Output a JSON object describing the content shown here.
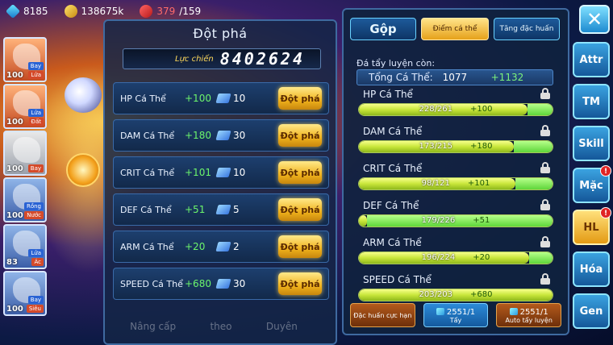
{
  "topbar": {
    "gems": "8185",
    "gold": "138675k",
    "energy_current": "379",
    "energy_max": "/159"
  },
  "team": [
    {
      "level": "100",
      "tag_a": "Bay",
      "tag_b": "Lửa",
      "style": "fire"
    },
    {
      "level": "100",
      "tag_a": "Lửa",
      "tag_b": "Đất",
      "style": "fire"
    },
    {
      "level": "100",
      "tag_a": "",
      "tag_b": "Bay",
      "style": "white"
    },
    {
      "level": "100",
      "tag_a": "Rồng",
      "tag_b": "Nước",
      "style": "blue"
    },
    {
      "level": "83",
      "tag_a": "Lửa",
      "tag_b": "Ác",
      "style": "blue"
    },
    {
      "level": "100",
      "tag_a": "Bay",
      "tag_b": "Siêu",
      "style": "blue"
    }
  ],
  "breakthrough": {
    "title": "Đột phá",
    "power_label": "Lực chiến",
    "power_value": "8402624",
    "button_label": "Đột phá",
    "rows": [
      {
        "name": "HP Cá Thể",
        "bonus": "+100",
        "qty": "10"
      },
      {
        "name": "DAM Cá Thể",
        "bonus": "+180",
        "qty": "30"
      },
      {
        "name": "CRIT Cá Thể",
        "bonus": "+101",
        "qty": "10"
      },
      {
        "name": "DEF Cá Thể",
        "bonus": "+51",
        "qty": "5"
      },
      {
        "name": "ARM Cá Thể",
        "bonus": "+20",
        "qty": "2"
      },
      {
        "name": "SPEED Cá Thể",
        "bonus": "+680",
        "qty": "30"
      }
    ]
  },
  "ghost_nav": [
    "Nâng cấp",
    "theo",
    "Duyên"
  ],
  "right": {
    "tabs": [
      "Gộp",
      "Điểm cá thể",
      "Tăng đặc huấn"
    ],
    "remain_label": "Đá tẩy luyện còn:",
    "total_label": "Tổng Cá Thể:",
    "total_value": "1077",
    "total_bonus": "+1132",
    "stats": [
      {
        "name": "HP Cá Thể",
        "value": "228/261",
        "bonus": "+100",
        "fill": 0.87,
        "bonus_fill": 0.13
      },
      {
        "name": "DAM Cá Thể",
        "value": "173/215",
        "bonus": "+180",
        "fill": 0.8,
        "bonus_fill": 0.2
      },
      {
        "name": "CRIT Cá Thể",
        "value": "98/121",
        "bonus": "+101",
        "fill": 0.81,
        "bonus_fill": 0.19
      },
      {
        "name": "DEF Cá Thể",
        "value": "179/226",
        "bonus": "+51",
        "fill": 0.04,
        "bonus_fill": 0.96
      },
      {
        "name": "ARM Cá Thể",
        "value": "196/224",
        "bonus": "+20",
        "fill": 0.88,
        "bonus_fill": 0.12
      },
      {
        "name": "SPEED Cá Thể",
        "value": "203/203",
        "bonus": "+680",
        "fill": 1.0,
        "bonus_fill": 0.0
      }
    ],
    "actions": {
      "special_label": "Đặc huấn cực hạn",
      "tay_count": "2551/1",
      "tay_label": "Tẩy",
      "auto_count": "2551/1",
      "auto_label": "Auto tẩy luyện"
    }
  },
  "side": {
    "close_label": "✕",
    "buttons": [
      {
        "label": "Attr",
        "badge": ""
      },
      {
        "label": "TM",
        "badge": ""
      },
      {
        "label": "Skill",
        "badge": ""
      },
      {
        "label": "Mặc",
        "badge": "!"
      },
      {
        "label": "HL",
        "badge": "!",
        "active": true
      },
      {
        "label": "Hóa",
        "badge": ""
      },
      {
        "label": "Gen",
        "badge": ""
      }
    ]
  },
  "colors": {
    "accent_gold": "#f0b21c",
    "panel_border": "#3f6aa0",
    "bonus_green": "#6cf56c",
    "badge_red": "#e02424"
  }
}
